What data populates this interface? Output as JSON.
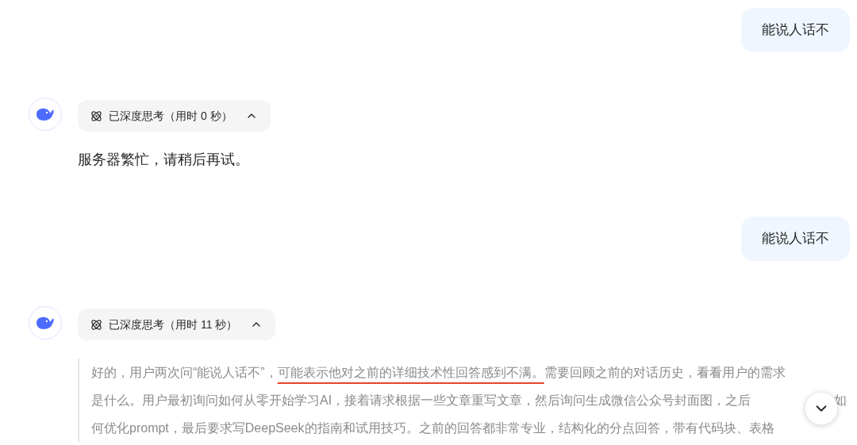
{
  "messages": [
    {
      "kind": "user",
      "text": "能说人话不"
    },
    {
      "kind": "assistant",
      "thinking": {
        "label": "已深度思考（用时 0 秒）",
        "expanded": true
      },
      "answer": "服务器繁忙，请稍后再试。"
    },
    {
      "kind": "user",
      "text": "能说人话不"
    },
    {
      "kind": "assistant",
      "thinking": {
        "label": "已深度思考（用时 11 秒）",
        "expanded": true,
        "lines": [
          {
            "kind": "plain",
            "parts": [
              {
                "text": "好的，用户两次问“能说人话不”，",
                "underlined": false
              },
              {
                "text": "可能表示他对之前的详细技术性回答感到不满。",
                "underlined": true
              },
              {
                "text": "需要回顾之前的对话历史，看看用户的需求",
                "underlined": false
              }
            ]
          },
          {
            "kind": "covered",
            "parts": [
              {
                "text": "是什么。用户最初询问如何从零开始学习AI，接着请求根据一些文章重写文章，然后询问生成微信公众号封面图，之后",
                "underlined": false
              },
              {
                "text": "如",
                "underlined": false
              }
            ]
          },
          {
            "kind": "plain",
            "parts": [
              {
                "text": "何优化prompt，最后要求写DeepSeek的指南和试用技巧。之前的回答都非常专业，结构化的分点回答，带有代码块、表格",
                "underlined": false
              }
            ]
          }
        ]
      }
    }
  ]
}
